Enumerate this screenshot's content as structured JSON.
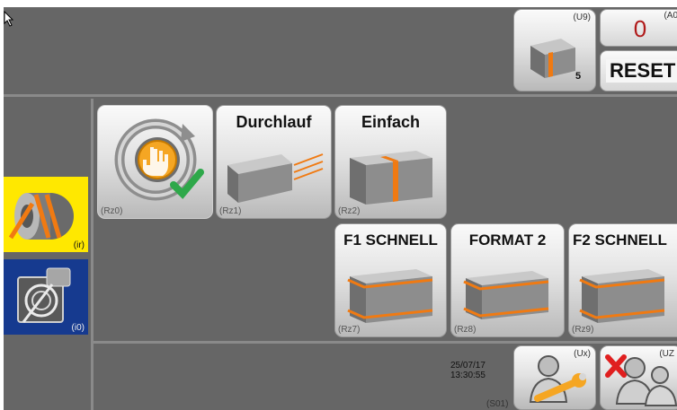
{
  "top_bar": {
    "counter_code": "(A0",
    "counter_value": "0",
    "reset_label": "RESET",
    "piece_button": {
      "code": "(U9)",
      "count": "5"
    }
  },
  "sidebar": [
    {
      "code": "(ir)",
      "icon": "orange-strap-roll-icon",
      "bg": "#ffe800"
    },
    {
      "code": "(i0)",
      "icon": "strapping-head-icon",
      "bg": "#163a8f"
    }
  ],
  "modes": {
    "auto": {
      "code": "(Rz0)",
      "icon": "manual-auto-cycle-icon"
    },
    "durchlauf": {
      "label": "Durchlauf",
      "code": "(Rz1)"
    },
    "einfach": {
      "label": "Einfach",
      "code": "(Rz2)"
    },
    "f1_schnell": {
      "label": "F1 SCHNELL",
      "code": "(Rz7)"
    },
    "format2": {
      "label": "FORMAT 2",
      "code": "(Rz8)"
    },
    "f2_schnell": {
      "label": "F2 SCHNELL",
      "code": "(Rz9)"
    }
  },
  "bottom_bar": {
    "date": "25/07/17",
    "time": "13:30:55",
    "screen_code": "(S01)",
    "service_button_code": "(Ux)",
    "logout_button_code": "(UZ"
  },
  "colors": {
    "panel": "#666666",
    "strap": "#f07a12",
    "accent_yellow": "#ffe800",
    "accent_blue": "#163a8f",
    "counter_red": "#b01a1a"
  }
}
